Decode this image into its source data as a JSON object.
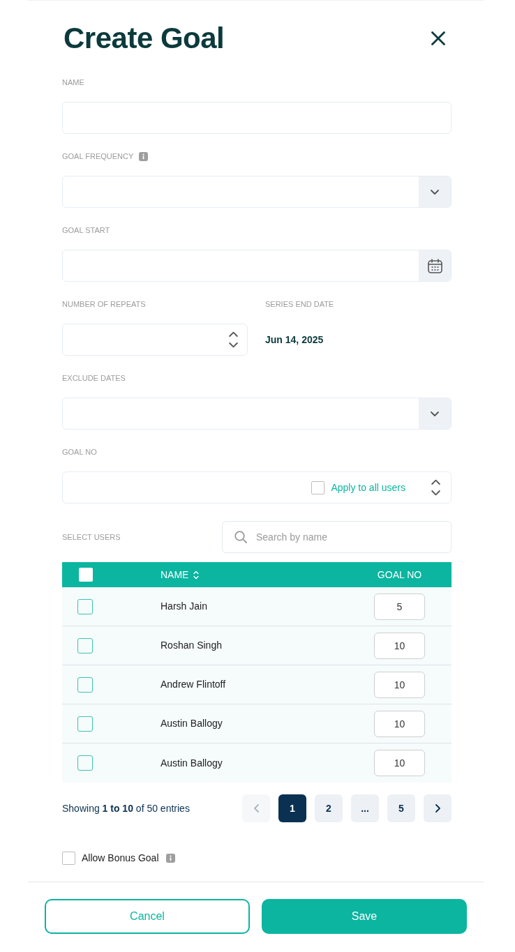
{
  "title": "Create Goal",
  "form": [
    {
      "kind": "text",
      "label": "NAME",
      "info": false
    },
    {
      "kind": "select",
      "label": "GOAL FREQUENCY",
      "info": true
    },
    {
      "kind": "date",
      "label": "GOAL START",
      "info": false
    },
    {
      "kind": "pair",
      "fields": [
        {
          "kind": "number",
          "label": "NUMBER OF REPEATS"
        },
        {
          "kind": "readout",
          "label": "SERIES END DATE",
          "value": "Jun 14, 2025"
        }
      ]
    },
    {
      "kind": "select",
      "label": "EXCLUDE DATES",
      "info": false
    },
    {
      "kind": "goal_no",
      "label": "GOAL NO",
      "info": false,
      "apply_all": {
        "label": "Apply to all users",
        "checked": false
      }
    }
  ],
  "users": {
    "label": "SELECT USERS",
    "search": {
      "placeholder": "Search by name"
    },
    "select_all": {
      "checked": false
    },
    "columns": [
      {
        "label": "NAME",
        "sortable": true
      },
      {
        "label": "GOAL NO",
        "sortable": false
      }
    ],
    "rows": [
      {
        "name": "Harsh Jain",
        "goal_no": "5",
        "checked": false
      },
      {
        "name": "Roshan Singh",
        "goal_no": "10",
        "checked": false
      },
      {
        "name": "Andrew Flintoff",
        "goal_no": "10",
        "checked": false
      },
      {
        "name": "Austin Ballogy",
        "goal_no": "10",
        "checked": false
      },
      {
        "name": "Austin Ballogy",
        "goal_no": "10",
        "checked": false
      }
    ]
  },
  "pagination": {
    "summary": "Showing **1 to 10** of 50 entries",
    "previous": {
      "disabled": true
    },
    "next": {
      "disabled": false
    },
    "pages": [
      {
        "label": "1",
        "selected": true
      },
      {
        "label": "2",
        "selected": false
      },
      {
        "label": "...",
        "selected": false
      },
      {
        "label": "5",
        "selected": false
      }
    ]
  },
  "bonus": {
    "label": "Allow Bonus Goal",
    "checked": false,
    "info": true
  },
  "buttons": [
    {
      "kind": "outline",
      "label": "Cancel"
    },
    {
      "kind": "primary",
      "label": "Save"
    }
  ]
}
